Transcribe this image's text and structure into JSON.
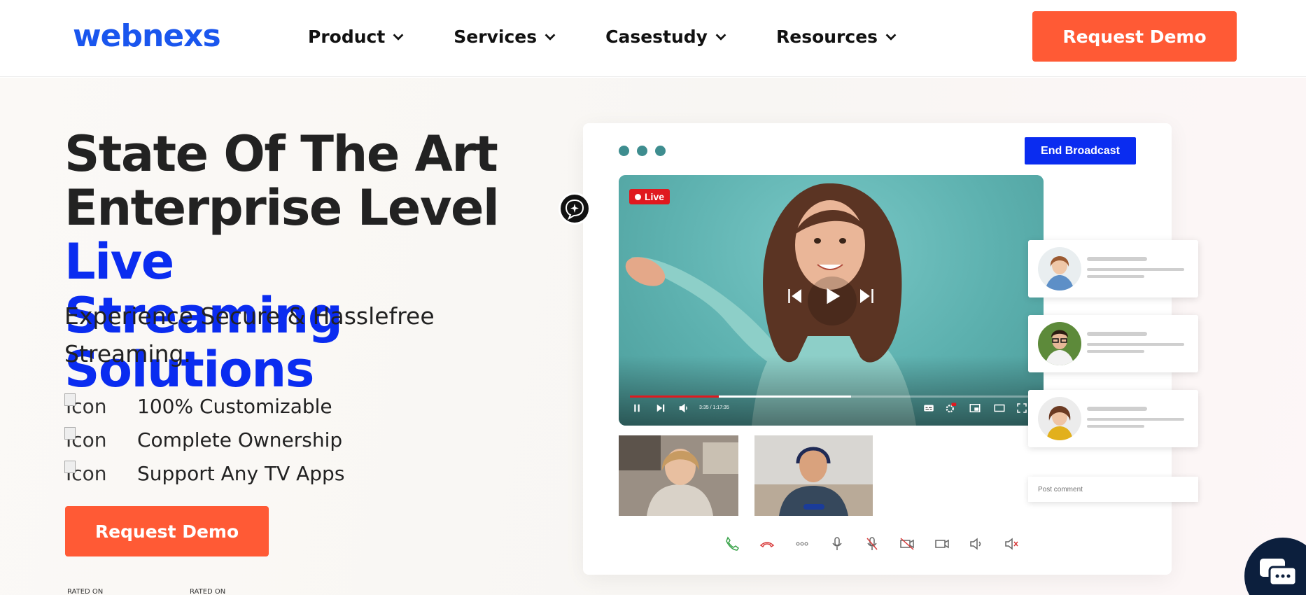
{
  "brand": {
    "name": "webnexs",
    "color": "#1a56ee"
  },
  "nav": {
    "items": [
      {
        "label": "Product"
      },
      {
        "label": "Services"
      },
      {
        "label": "Casestudy"
      },
      {
        "label": "Resources"
      }
    ]
  },
  "header": {
    "cta_label": "Request Demo"
  },
  "hero": {
    "title_line1": "State Of The Art",
    "title_line2_dark": "Enterprise Level ",
    "title_line2_blue": "Live",
    "title_line3_blue": "Streaming Solutions",
    "subtitle": "Experience Secure & Hasslefree Streaming.",
    "features": [
      {
        "icon_alt": "Icon",
        "label": "100% Customizable"
      },
      {
        "icon_alt": "Icon",
        "label": "Complete Ownership"
      },
      {
        "icon_alt": "Icon",
        "label": "Support Any TV Apps"
      }
    ],
    "cta_label": "Request Demo",
    "rated_1": "RATED ON",
    "rated_2": "RATED ON"
  },
  "player": {
    "end_broadcast_label": "End Broadcast",
    "live_label": "Live",
    "time": "3:35 / 1:17:35",
    "progress": 0.22,
    "buffered": 0.55,
    "comment_placeholder": "Post comment"
  },
  "colors": {
    "accent": "#ff5a35",
    "blue": "#0a2cf0",
    "teal": "#3e8d8f",
    "live_red": "#e0191f"
  }
}
